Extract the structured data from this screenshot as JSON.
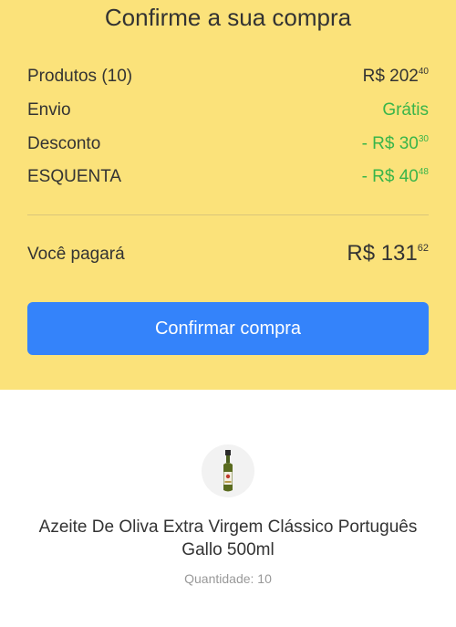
{
  "header": {
    "title": "Confirme a sua compra"
  },
  "summary": {
    "rows": [
      {
        "label": "Produtos (10)",
        "value_main": "R$ 202",
        "value_cents": "40",
        "color": "#333333"
      },
      {
        "label": "Envio",
        "value_main": "Grátis",
        "value_cents": "",
        "color": "#39b54a"
      },
      {
        "label": "Desconto",
        "value_main": "- R$ 30",
        "value_cents": "30",
        "color": "#39b54a"
      },
      {
        "label": "ESQUENTA",
        "value_main": "- R$ 40",
        "value_cents": "48",
        "color": "#39b54a"
      }
    ],
    "total": {
      "label": "Você pagará",
      "value_main": "R$ 131",
      "value_cents": "62"
    }
  },
  "confirm_button": {
    "label": "Confirmar compra",
    "color": "#3483fa"
  },
  "product": {
    "icon": "olive-oil-bottle-icon",
    "name": "Azeite De Oliva Extra Virgem Clássico Português Gallo 500ml",
    "quantity": "Quantidade: 10"
  },
  "colors": {
    "background_yellow": "#fbe27a",
    "accent_blue": "#3483fa",
    "discount_green": "#39b54a"
  }
}
